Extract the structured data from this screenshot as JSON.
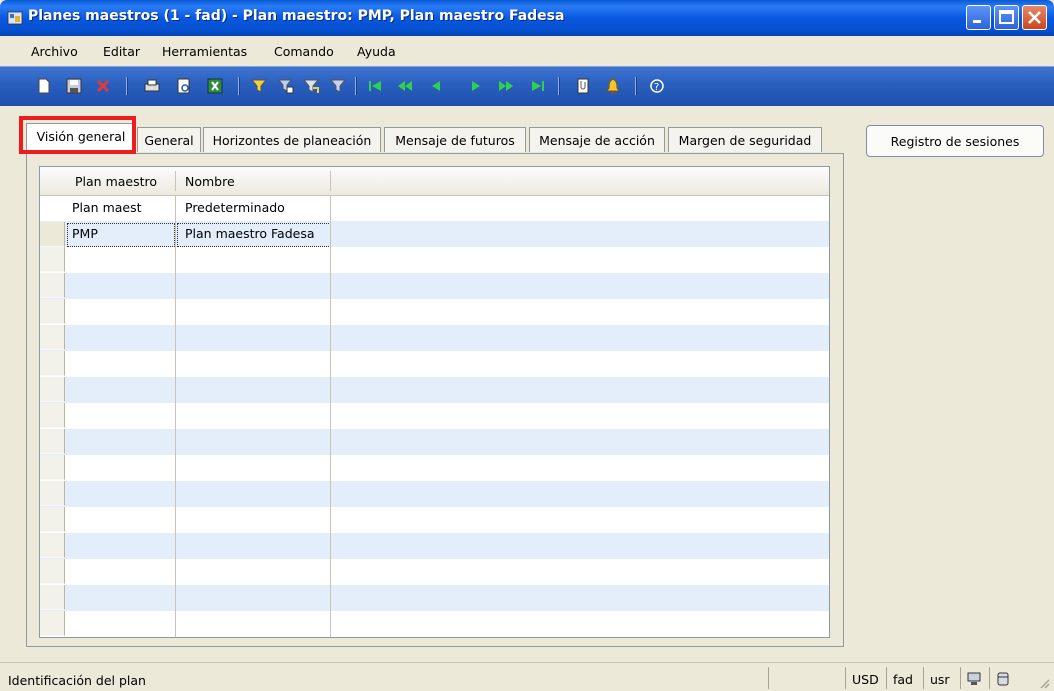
{
  "window": {
    "title": "Planes maestros (1 - fad) - Plan maestro: PMP, Plan maestro Fadesa"
  },
  "menu": [
    "Archivo",
    "Editar",
    "Herramientas",
    "Comando",
    "Ayuda"
  ],
  "toolbar_icons": [
    "new-icon",
    "save-icon",
    "delete-icon",
    "print-icon",
    "print-preview-icon",
    "excel-export-icon",
    "filter-by-selection-icon",
    "filter-by-grid-icon",
    "advanced-filter-icon",
    "remove-filter-icon",
    "first-record-icon",
    "previous-page-icon",
    "previous-record-icon",
    "next-record-icon",
    "next-page-icon",
    "last-record-icon",
    "attachments-icon",
    "alert-icon",
    "help-icon"
  ],
  "tabs": [
    "Visión general",
    "General",
    "Horizontes de planeación",
    "Mensaje de futuros",
    "Mensaje de acción",
    "Margen de seguridad"
  ],
  "side_button": "Registro de sesiones",
  "grid": {
    "columns": [
      "Plan maestro",
      "Nombre"
    ],
    "rows": [
      {
        "plan": "Plan maest",
        "nombre": "Predeterminado"
      },
      {
        "plan": "PMP",
        "nombre": "Plan maestro Fadesa"
      }
    ]
  },
  "status": {
    "text": "Identificación del plan",
    "currency": "USD",
    "company": "fad",
    "layer": "usr"
  },
  "colors": {
    "highlight": "#ee1c1c",
    "title_bar": "#0a58e0",
    "row_alt": "#e4eefb"
  }
}
